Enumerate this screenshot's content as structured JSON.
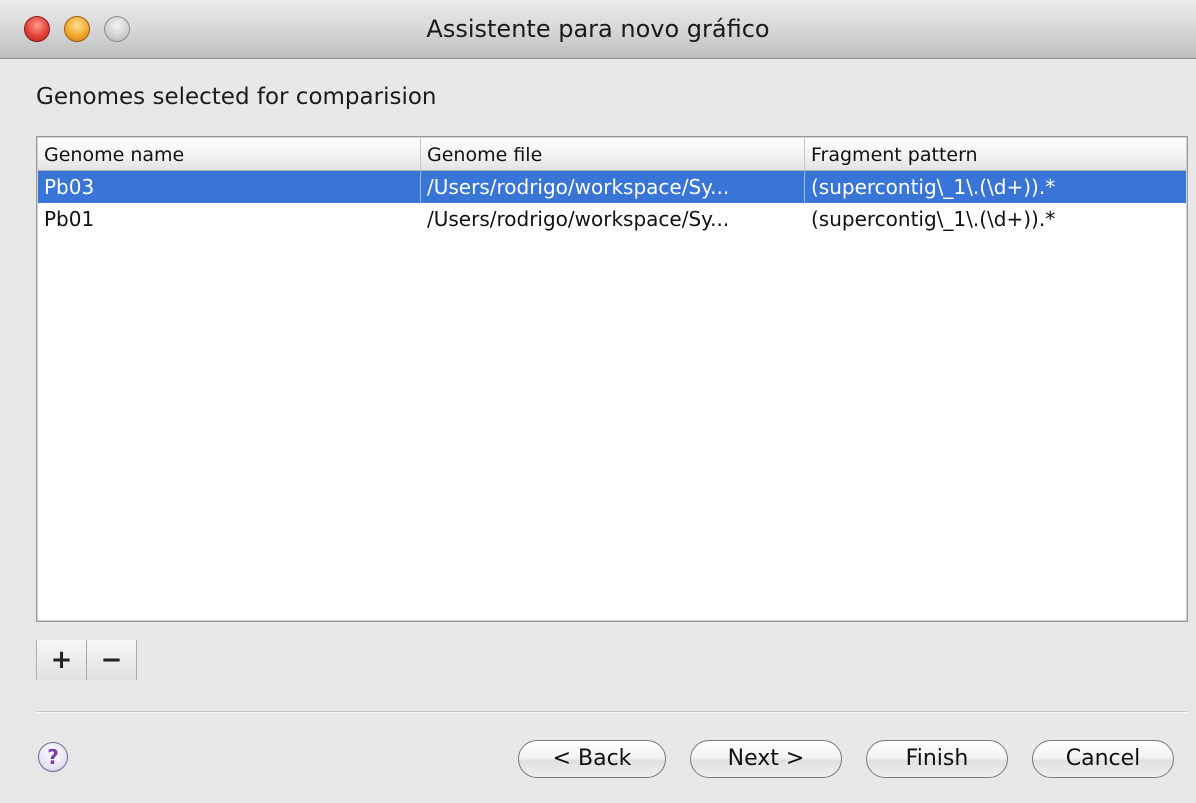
{
  "window": {
    "title": "Assistente para novo gráfico"
  },
  "section": {
    "label": "Genomes selected for comparision"
  },
  "table": {
    "columns": [
      "Genome name",
      "Genome file",
      "Fragment pattern"
    ],
    "rows": [
      {
        "name": "Pb03",
        "file": "/Users/rodrigo/workspace/Sy...",
        "pattern": "(supercontig\\_1\\.(\\d+)).*",
        "selected": true
      },
      {
        "name": "Pb01",
        "file": "/Users/rodrigo/workspace/Sy...",
        "pattern": "(supercontig\\_1\\.(\\d+)).*",
        "selected": false
      }
    ]
  },
  "controls": {
    "add_label": "+",
    "remove_label": "−",
    "help_label": "?"
  },
  "buttons": {
    "back": "< Back",
    "next": "Next >",
    "finish": "Finish",
    "cancel": "Cancel"
  },
  "colors": {
    "selection": "#3875d7",
    "close": "#e0443a",
    "minimize": "#f2a92c",
    "zoom": "#cfcfcf"
  }
}
